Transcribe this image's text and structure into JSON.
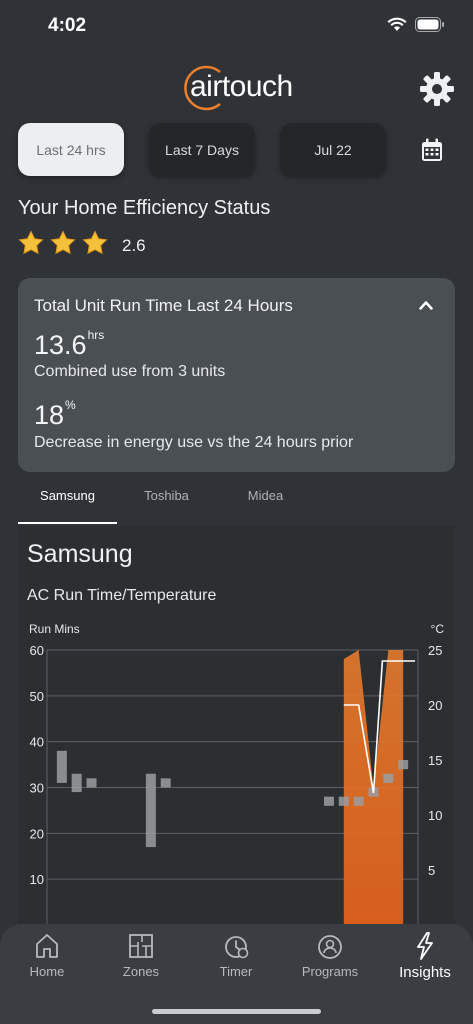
{
  "status_bar": {
    "time": "4:02"
  },
  "brand": {
    "logo_text": "airtouch",
    "accent_color": "#f07f2c"
  },
  "header": {
    "settings_icon": "gear-icon"
  },
  "range_buttons": [
    {
      "label": "Last 24 hrs",
      "selected": true
    },
    {
      "label": "Last 7 Days",
      "selected": false
    },
    {
      "label": "Jul 22",
      "selected": false
    }
  ],
  "calendar_icon": "calendar-icon",
  "efficiency": {
    "title": "Your Home Efficiency Status",
    "stars": 3,
    "rating": "2.6"
  },
  "summary_card": {
    "title": "Total Unit Run Time Last 24 Hours",
    "run_time_value": "13.6",
    "run_time_unit": "hrs",
    "run_time_caption": "Combined use from 3 units",
    "decrease_value": "18",
    "decrease_unit": "%",
    "decrease_caption": "Decrease in energy use vs the 24 hours prior"
  },
  "unit_tabs": [
    {
      "label": "Samsung",
      "selected": true
    },
    {
      "label": "Toshiba",
      "selected": false
    },
    {
      "label": "Midea",
      "selected": false
    }
  ],
  "unit_section": {
    "title": "Samsung",
    "chart_title": "AC Run Time/Temperature"
  },
  "chart_data": {
    "type": "area",
    "title": "AC Run Time/Temperature",
    "y_left_label": "Run Mins",
    "y_right_label": "°C",
    "y_left_ticks": [
      "60",
      "50",
      "40",
      "30",
      "20",
      "10"
    ],
    "y_right_ticks": [
      "25",
      "20",
      "15",
      "10",
      "5"
    ],
    "ylim_left": [
      0,
      60
    ],
    "ylim_right": [
      0,
      25
    ],
    "grid": true,
    "x_hours": [
      20,
      21,
      22,
      23,
      24
    ],
    "run_minutes": [
      58,
      60,
      30,
      60,
      60
    ],
    "candles": [
      {
        "x": 1,
        "low": 31,
        "high": 38
      },
      {
        "x": 2,
        "low": 29,
        "high": 33
      },
      {
        "x": 3,
        "low": 30,
        "high": 32
      },
      {
        "x": 7,
        "low": 17,
        "high": 33
      },
      {
        "x": 8,
        "low": 30,
        "high": 32
      },
      {
        "x": 19,
        "low": 26,
        "high": 28
      },
      {
        "x": 20,
        "low": 26,
        "high": 28
      },
      {
        "x": 21,
        "low": 26,
        "high": 28
      },
      {
        "x": 22,
        "low": 28,
        "high": 30
      },
      {
        "x": 23,
        "low": 31,
        "high": 33
      },
      {
        "x": 24,
        "low": 34,
        "high": 36
      }
    ],
    "setpoint_x": [
      20,
      21,
      22,
      22.6,
      24.8
    ],
    "setpoint_c": [
      20,
      20,
      12,
      24,
      24
    ]
  },
  "bottom_nav": [
    {
      "label": "Home",
      "icon": "home-icon",
      "active": false
    },
    {
      "label": "Zones",
      "icon": "zones-icon",
      "active": false
    },
    {
      "label": "Timer",
      "icon": "timer-icon",
      "active": false
    },
    {
      "label": "Programs",
      "icon": "programs-icon",
      "active": false
    },
    {
      "label": "Insights",
      "icon": "insights-icon",
      "active": true
    }
  ]
}
